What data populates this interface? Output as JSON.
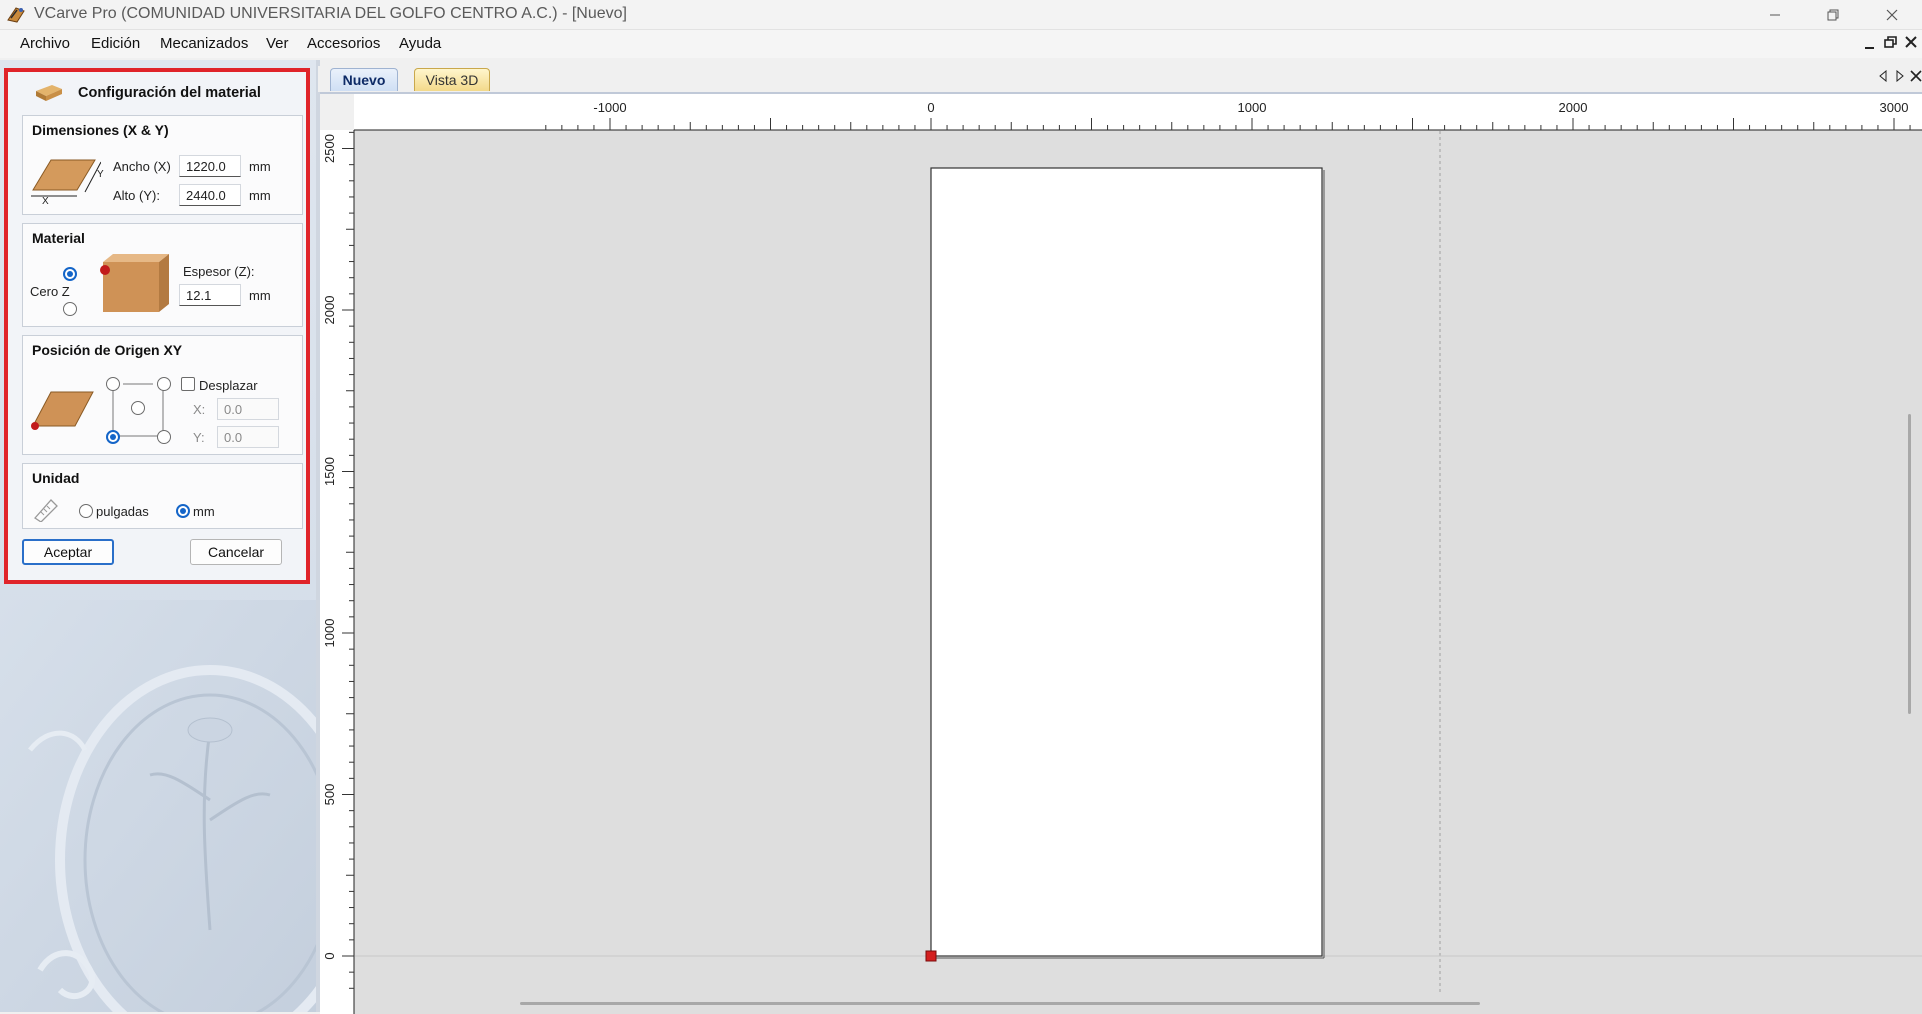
{
  "titlebar": {
    "title": "VCarve Pro (COMUNIDAD UNIVERSITARIA DEL GOLFO CENTRO  A.C.) - [Nuevo]",
    "app_icon": "vcarve-logo-icon",
    "controls": [
      "minimize-icon",
      "restore-icon",
      "close-icon"
    ]
  },
  "menubar": {
    "items": [
      "Archivo",
      "Edición",
      "Mecanizados",
      "Ver",
      "Accesorios",
      "Ayuda"
    ],
    "mdi_controls": [
      "minimize-icon",
      "restore-icon",
      "close-icon"
    ]
  },
  "material_dialog": {
    "title": "Configuración del material",
    "highlight_color": "#e0242a",
    "dimensions": {
      "heading": "Dimensiones (X & Y)",
      "x_axis": "X",
      "y_axis": "Y",
      "width_label": "Ancho (X)",
      "width_value": "1220.0",
      "width_unit": "mm",
      "height_label": "Alto (Y):",
      "height_value": "2440.0",
      "height_unit": "mm"
    },
    "material": {
      "heading": "Material",
      "zero_label": "Cero Z",
      "zero_top_selected": true,
      "thickness_label": "Espesor (Z):",
      "thickness_value": "12.1",
      "thickness_unit": "mm"
    },
    "origin": {
      "heading": "Posición de Origen XY",
      "selected": "bottom-left",
      "offset_label": "Desplazar",
      "offset_checked": false,
      "x_label": "X:",
      "x_value": "0.0",
      "y_label": "Y:",
      "y_value": "0.0"
    },
    "units": {
      "heading": "Unidad",
      "inches_label": "pulgadas",
      "mm_label": "mm",
      "selected": "mm"
    },
    "accept_label": "Aceptar",
    "cancel_label": "Cancelar"
  },
  "tabs": [
    {
      "label": "Nuevo",
      "active": true
    },
    {
      "label": "Vista 3D",
      "active": false
    }
  ],
  "tab_controls": [
    "tab-left-icon",
    "tab-right-icon",
    "tab-close-icon"
  ],
  "rulers": {
    "horizontal_labels": [
      "-1000",
      "0",
      "1000",
      "2000",
      "3000"
    ],
    "vertical_labels": [
      "2500",
      "2000",
      "1500",
      "1000",
      "500",
      "0"
    ]
  },
  "canvas": {
    "sheet_width_mm": 1220,
    "sheet_height_mm": 2440,
    "origin_marker_color": "#d42020",
    "background_color": "#dedede",
    "sheet_color": "#ffffff"
  }
}
